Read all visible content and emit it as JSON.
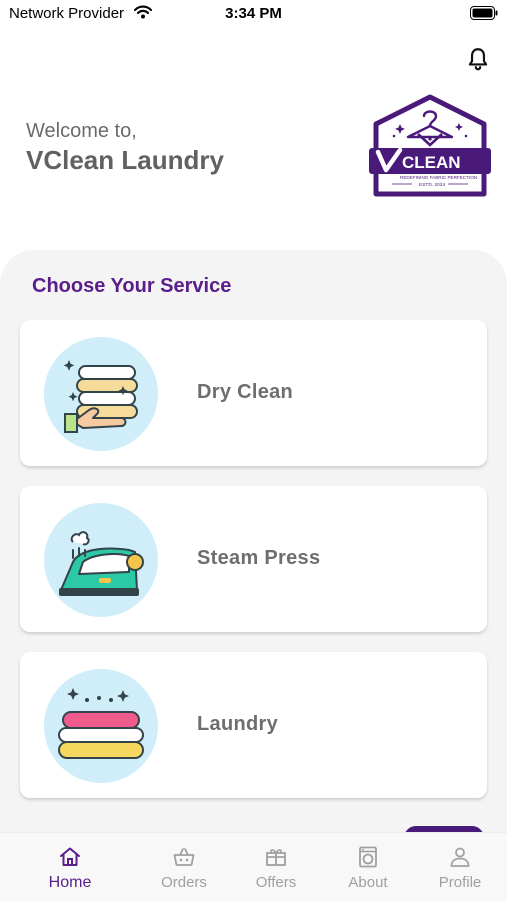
{
  "status_bar": {
    "carrier": "Network Provider",
    "time": "3:34 PM"
  },
  "header": {
    "welcome": "Welcome to,",
    "app_name": "VClean Laundry",
    "logo": {
      "brand": "CLEAN",
      "tagline": "REDEFINING FABRIC PERFECTION",
      "est": "ESTD. 2024"
    }
  },
  "section_title": "Choose Your Service",
  "services": [
    {
      "label": "Dry Clean",
      "icon": "folded-clothes-hand-icon"
    },
    {
      "label": "Steam Press",
      "icon": "steam-iron-icon"
    },
    {
      "label": "Laundry",
      "icon": "folded-towels-icon"
    }
  ],
  "tabs": [
    {
      "label": "Home",
      "icon": "home-icon",
      "active": true
    },
    {
      "label": "Orders",
      "icon": "basket-icon",
      "active": false
    },
    {
      "label": "Offers",
      "icon": "gift-icon",
      "active": false
    },
    {
      "label": "About",
      "icon": "washing-machine-icon",
      "active": false
    },
    {
      "label": "Profile",
      "icon": "person-icon",
      "active": false
    }
  ],
  "colors": {
    "brand_purple": "#5a1e8c",
    "tab_inactive": "#a0a0a0",
    "sheet_bg": "#f4f4f5",
    "icon_circle": "#cfeefa"
  }
}
